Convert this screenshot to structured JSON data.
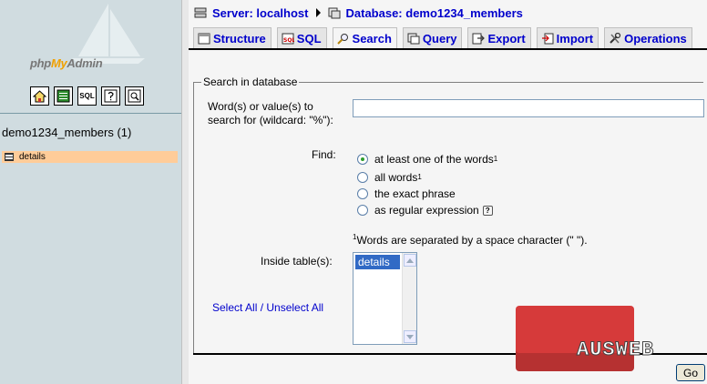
{
  "left": {
    "logo": {
      "part1": "php",
      "part2": "My",
      "part3": "Admin"
    },
    "nav_icons": [
      {
        "icon": "home-icon"
      },
      {
        "icon": "docs-icon"
      },
      {
        "icon": "sql-icon",
        "text": "SQL"
      },
      {
        "icon": "help-icon"
      },
      {
        "icon": "query-icon"
      }
    ],
    "db_name": "demo1234_members (1)",
    "tables": [
      {
        "label": "details"
      }
    ]
  },
  "breadcrumb": {
    "server": "Server: localhost",
    "database": "Database: demo1234_members"
  },
  "tabs": [
    {
      "label": "Structure",
      "icon": "structure-icon"
    },
    {
      "label": "SQL",
      "icon": "sql-icon"
    },
    {
      "label": "Search",
      "icon": "search-icon",
      "active": true
    },
    {
      "label": "Query",
      "icon": "query-icon"
    },
    {
      "label": "Export",
      "icon": "export-icon"
    },
    {
      "label": "Import",
      "icon": "import-icon"
    },
    {
      "label": "Operations",
      "icon": "operations-icon"
    }
  ],
  "search": {
    "legend": "Search in database",
    "words_label": "Word(s) or value(s) to search for (wildcard: \"%\"):",
    "words_value": "",
    "find_label": "Find:",
    "options": [
      {
        "label": "at least one of the words",
        "sup": "1",
        "selected": true
      },
      {
        "label": "all words",
        "sup": "1",
        "selected": false
      },
      {
        "label": "the exact phrase",
        "sup": "",
        "selected": false
      },
      {
        "label": "as regular expression",
        "sup": "",
        "selected": false
      }
    ],
    "footnote_sup": "1",
    "footnote": "Words are separated by a space character (\" \").",
    "tables_label": "Inside table(s):",
    "tables_options": [
      "details"
    ],
    "select_all": "Select All",
    "link_sep": " / ",
    "unselect_all": "Unselect All",
    "go_label": "Go"
  },
  "watermark": {
    "text": "AUSWEB"
  },
  "colors": {
    "link": "#0000cc",
    "left_bg": "#d0dce0",
    "selected_table": "#ffcc99"
  }
}
